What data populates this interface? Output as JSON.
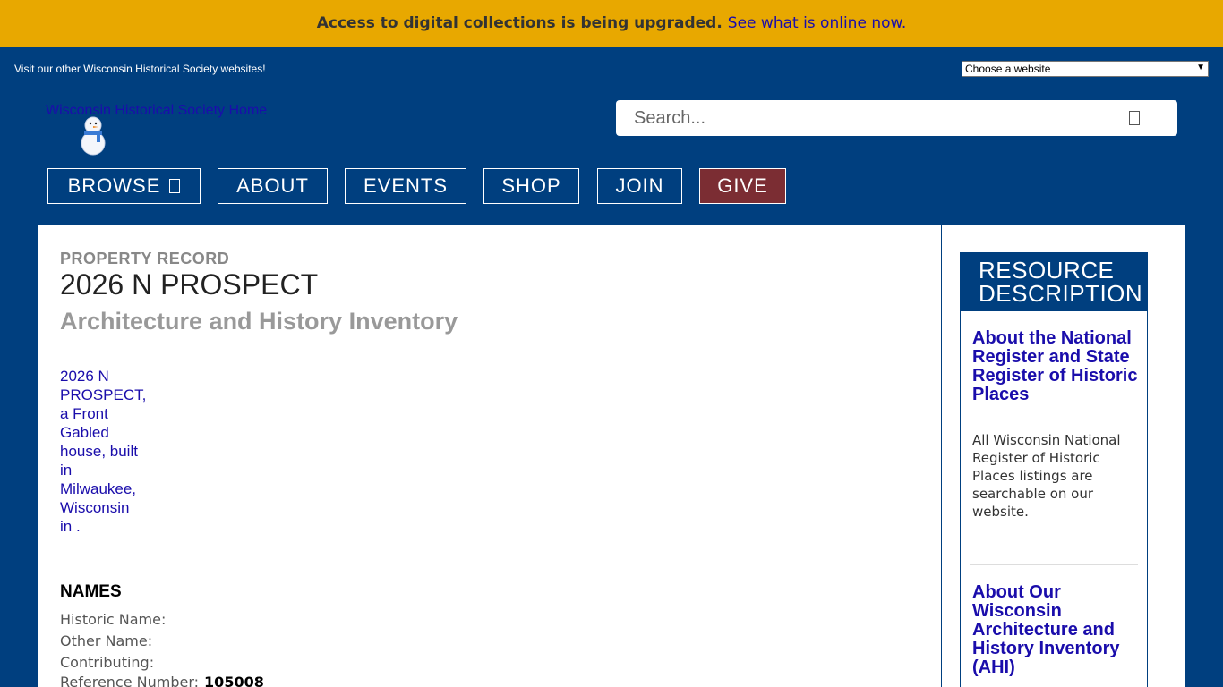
{
  "alert": {
    "message": "Access to digital collections is being upgraded.",
    "link": "See what is online now."
  },
  "topbar": {
    "visit_text": "Visit our other Wisconsin Historical Society websites!",
    "site_select": "Choose a website"
  },
  "logo": {
    "alt": "Wisconsin Historical Society Home"
  },
  "search": {
    "placeholder": "Search...",
    "button_icon": "search-icon"
  },
  "nav": {
    "browse": "BROWSE",
    "about": "ABOUT",
    "events": "EVENTS",
    "shop": "SHOP",
    "join": "JOIN",
    "give": "GIVE"
  },
  "record": {
    "kicker": "PROPERTY RECORD",
    "title": "2026 N PROSPECT",
    "subtitle": "Architecture and History Inventory",
    "photo_alt": "2026 N PROSPECT, a Front Gabled house, built in Milwaukee, Wisconsin in ."
  },
  "names": {
    "heading": "NAMES",
    "historic_label": "Historic Name:",
    "other_label": "Other Name:",
    "contributing_label": "Contributing:",
    "reference_label": "Reference Number:",
    "reference_value": "105008"
  },
  "sidebar": {
    "heading": "RESOURCE DESCRIPTION",
    "link1": "About the National Register and State Register of Historic Places",
    "text1": "All Wisconsin National Register of Historic Places listings are searchable on our website.",
    "link2": "About Our Wisconsin Architecture and History Inventory (AHI)"
  },
  "colors": {
    "brand_blue": "#003f7f",
    "alert_gold": "#e8a800",
    "give_red": "#7b2d33",
    "link": "#1a0dab"
  }
}
